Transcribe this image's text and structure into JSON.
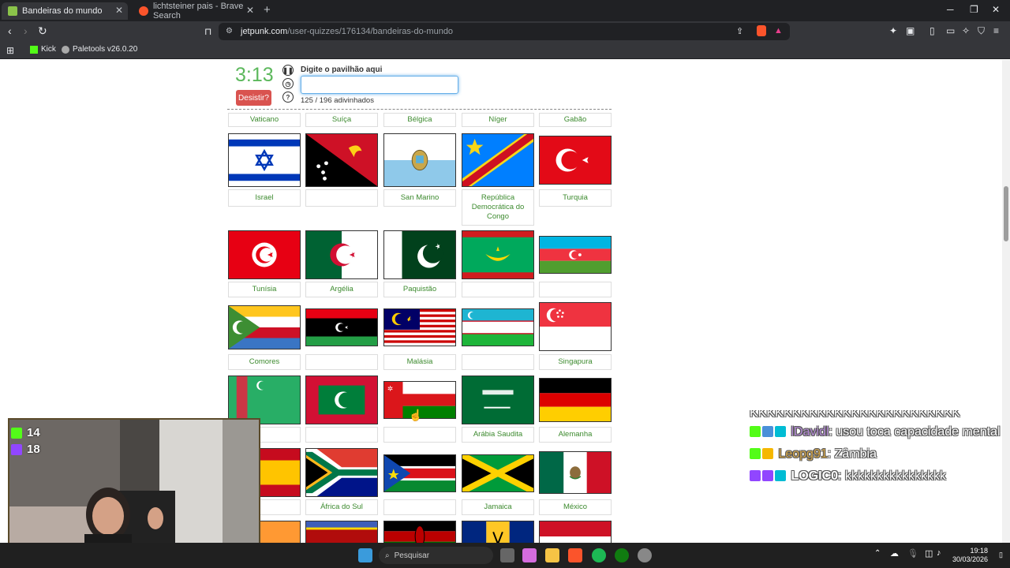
{
  "browser": {
    "tabs": [
      {
        "title": "Bandeiras do mundo",
        "active": true
      },
      {
        "title": "lichtsteiner pais - Brave Search",
        "active": false
      }
    ],
    "url_domain": "jetpunk.com",
    "url_path": "/user-quizzes/176134/bandeiras-do-mundo",
    "bookmarks": [
      "Kick",
      "Paletools v26.0.20"
    ]
  },
  "quiz": {
    "timer": "3:13",
    "give_up": "Desistir?",
    "prompt": "Digite o pavilhão aqui",
    "answer_value": "",
    "progress": "125 / 196 adivinhados"
  },
  "top_labels": [
    "Vaticano",
    "Suíça",
    "Bélgica",
    "Níger",
    "Gabão"
  ],
  "rows": [
    [
      "Israel",
      "",
      "San Marino",
      "República Democrática do Congo",
      "Turquia"
    ],
    [
      "Tunísia",
      "Argélia",
      "Paquistão",
      "",
      ""
    ],
    [
      "Comores",
      "",
      "Malásia",
      "",
      "Singapura"
    ],
    [
      "",
      "",
      "",
      "Arábia Saudita",
      "Alemanha"
    ],
    [
      "anha",
      "África do Sul",
      "",
      "Jamaica",
      "México"
    ]
  ],
  "stream": {
    "kick_viewers": "14",
    "twitch_viewers": "18",
    "chat": [
      {
        "user": "",
        "msg": "KKKKKKKKKKKKKKKKKKKKKKKKK"
      },
      {
        "user": "lDavidl",
        "msg": ": usou toca capacidade mental",
        "color": "#b58bd6"
      },
      {
        "user": "Leopg91",
        "msg": ": Zâmbia",
        "color": "#d4a64a"
      },
      {
        "user": "LOGIC0",
        "msg": ": kkkkkkkkkkkkkkkk",
        "color": "#ffffff"
      }
    ]
  },
  "taskbar": {
    "search": "Pesquisar",
    "time": "19:18",
    "date": "30/03/2026"
  }
}
